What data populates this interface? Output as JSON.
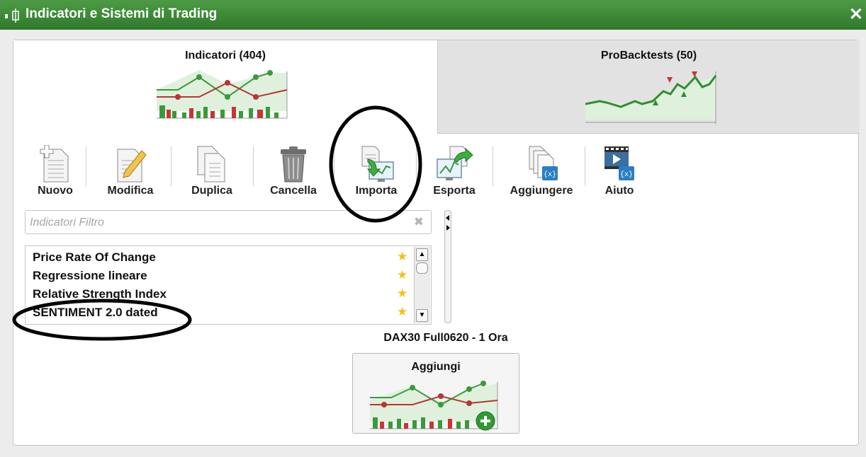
{
  "window": {
    "title": "Indicatori e Sistemi di Trading",
    "close_glyph": "✕"
  },
  "tabs": [
    {
      "label": "Indicatori (404)",
      "active": true
    },
    {
      "label": "ProBacktests (50)",
      "active": false
    }
  ],
  "toolbar": [
    {
      "label": "Nuovo",
      "icon": "new-document-icon"
    },
    {
      "label": "Modifica",
      "icon": "edit-pencil-icon"
    },
    {
      "label": "Duplica",
      "icon": "duplicate-icon"
    },
    {
      "label": "Cancella",
      "icon": "trash-icon"
    },
    {
      "label": "Importa",
      "icon": "import-icon"
    },
    {
      "label": "Esporta",
      "icon": "export-icon"
    },
    {
      "label": "Aggiungere",
      "icon": "add-code-icon"
    },
    {
      "label": "Aiuto",
      "icon": "help-video-icon"
    }
  ],
  "filter": {
    "placeholder": "Indicatori Filtro",
    "value": ""
  },
  "list": {
    "items": [
      {
        "label": "Price Rate Of Change",
        "favorite": true
      },
      {
        "label": "Regressione lineare",
        "favorite": true
      },
      {
        "label": "Relative Strength Index",
        "favorite": true
      },
      {
        "label": "SENTIMENT 2.0 dated",
        "favorite": true
      }
    ]
  },
  "context": {
    "instrument": "DAX30 Full0620 - 1 Ora"
  },
  "add_button": {
    "label": "Aggiungi"
  },
  "colors": {
    "titlebar": "#3f8a39",
    "accent_green": "#2e9a33",
    "star": "#f4c10f",
    "annotation": "#000000"
  }
}
